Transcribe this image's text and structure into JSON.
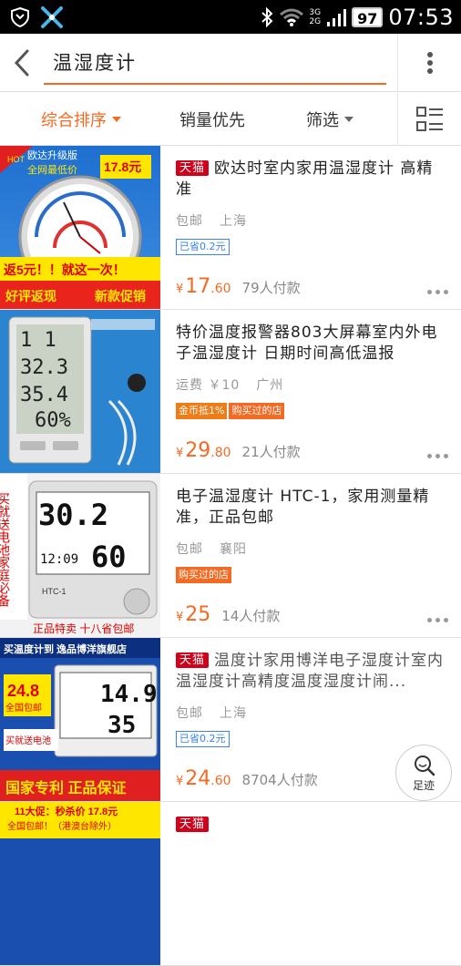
{
  "status_bar": {
    "time": "07:53",
    "battery": "97",
    "net_top": "3G",
    "net_bottom": "2G"
  },
  "header": {
    "query": "温湿度计"
  },
  "sort_bar": {
    "comprehensive": "综合排序",
    "sales": "销量优先",
    "filter": "筛选"
  },
  "items": [
    {
      "badge": "天猫",
      "title": "欧达时室内家用温湿度计 高精准",
      "shipping": "包邮",
      "location": "上海",
      "tags": [
        "已省0.2元"
      ],
      "price_int": "17",
      "price_dec": ".60",
      "sold": "79人付款",
      "thumb": {
        "top_text": "欧达升级版",
        "sub_text": "全网最低价",
        "price_tag": "17.8元",
        "banner1": "返5元！！就这一次！",
        "banner2a": "好评返现",
        "banner2b": "新款促销",
        "hot": "HOT"
      }
    },
    {
      "badge": "",
      "title": "特价温度报警器803大屏幕室内外电子温湿度计 日期时间高低温报",
      "shipping": "运费 ￥10",
      "location": "广州",
      "tags": [
        "金币抵1%",
        "购买过的店"
      ],
      "price_int": "29",
      "price_dec": ".80",
      "sold": "21人付款",
      "thumb": {
        "d1": "1 1",
        "d2": "32.3",
        "d3": "35.4",
        "d4": "60%"
      }
    },
    {
      "badge": "",
      "title": "电子温湿度计 HTC-1，家用测量精准，正品包邮",
      "shipping": "包邮",
      "location": "襄阳",
      "tags": [
        "购买过的店"
      ],
      "price_int": "25",
      "price_dec": "",
      "sold": "14人付款",
      "thumb": {
        "temp": "30.2",
        "time": "12:09",
        "hum": "60",
        "model": "HTC-1",
        "vertical": "买就送电池家庭必备",
        "bottom": "正品特卖 十八省包邮"
      }
    },
    {
      "badge": "天猫",
      "title": "温度计家用博洋电子湿度计室内温湿度计高精度温度湿度计闹...",
      "shipping": "包邮",
      "location": "上海",
      "tags": [
        "已省0.2元"
      ],
      "price_int": "24",
      "price_dec": ".60",
      "sold": "8704人付款",
      "thumb": {
        "top": "买温度计到 逸品博洋旗舰店",
        "price": "24.8",
        "free": "全国包邮",
        "temp": "14.9",
        "hum": "35",
        "battery": "买就送电池",
        "bottom": "国家专利 正品保证"
      }
    },
    {
      "badge": "天猫",
      "title": "",
      "shipping": "",
      "location": "",
      "tags": [],
      "price_int": "",
      "price_dec": "",
      "sold": "",
      "thumb": {
        "top": "11大促：秒杀价 17.8元",
        "sub": "全国包邮！（港澳台除外）"
      }
    }
  ],
  "footprint": {
    "label": "足迹"
  },
  "colors": {
    "accent": "#f46a22",
    "tmall": "#d0021b"
  }
}
